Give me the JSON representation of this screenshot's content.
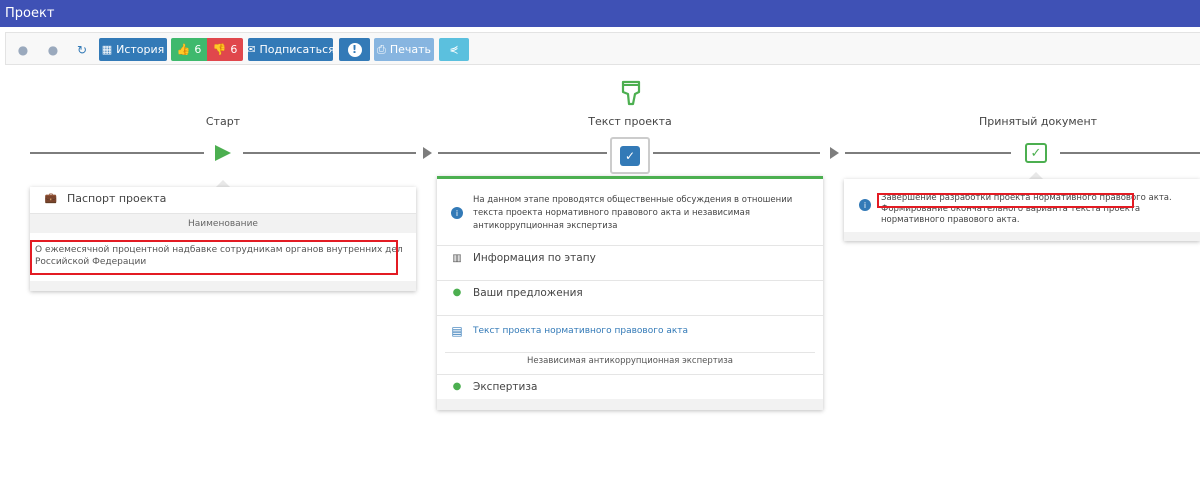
{
  "header": {
    "title": "Проект"
  },
  "toolbar": {
    "history": "История",
    "likes": "6",
    "dislikes": "6",
    "subscribe": "Подписаться",
    "print": "Печать"
  },
  "stages": {
    "start": {
      "label": "Старт"
    },
    "text": {
      "label": "Текст проекта"
    },
    "accepted": {
      "label": "Принятый документ"
    }
  },
  "start_card": {
    "title": "Паспорт проекта",
    "section": "Наименование",
    "name_text": "О ежемесячной процентной надбавке сотрудникам органов внутренних дел Российской Федерации"
  },
  "text_card": {
    "info": "На данном этапе проводятся общественные обсуждения в отношении текста проекта нормативного правового акта и независимая антикоррупционная экспертиза",
    "items": [
      {
        "label": "Информация по этапу"
      },
      {
        "label": "Ваши предложения"
      },
      {
        "label": "Текст проекта нормативного правового акта"
      }
    ],
    "section": "Независимая антикоррупционная экспертиза",
    "expertise": "Экспертиза"
  },
  "accepted_card": {
    "highlight": "Завершение разработки проекта нормативного правового акта.",
    "rest": "Формирование окончательного варианта текста проекта нормативного правового акта."
  },
  "colors": {
    "header": "#3f51b5",
    "accent_green": "#4caf50",
    "highlight_red": "#e31b23",
    "button_blue": "#337ab7"
  }
}
